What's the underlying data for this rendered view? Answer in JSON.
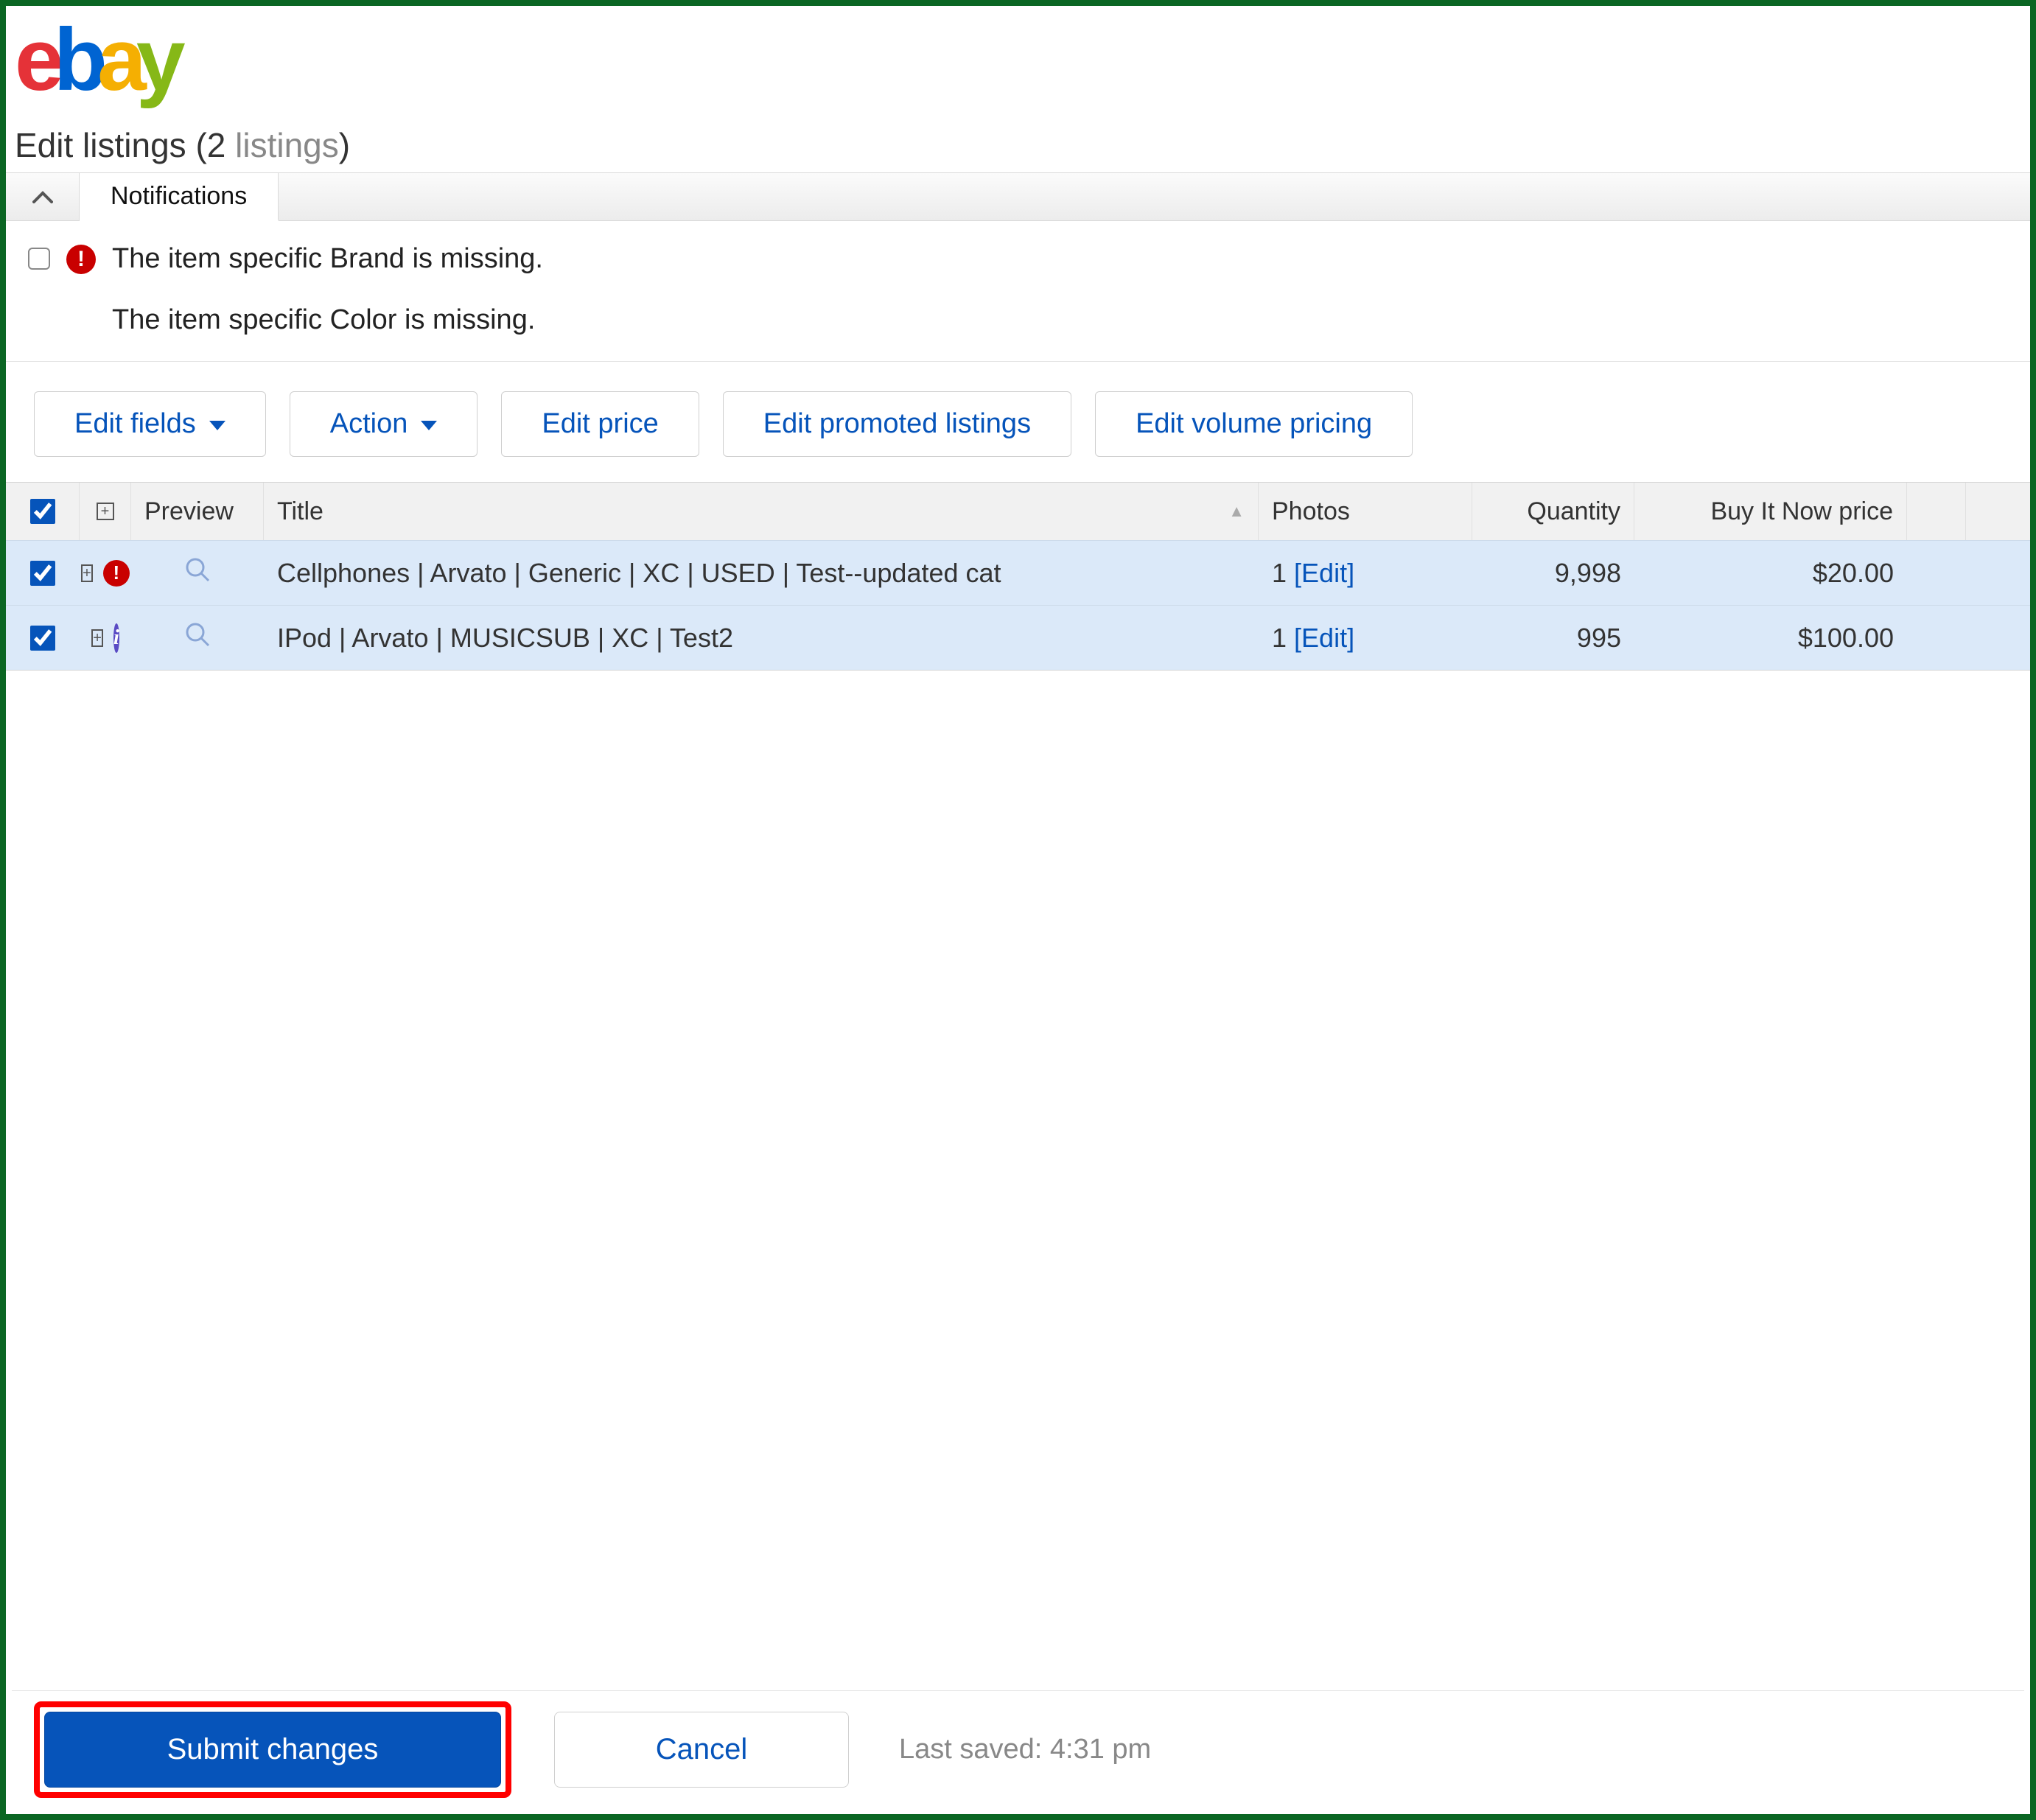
{
  "logo": {
    "letters": [
      "e",
      "b",
      "a",
      "y"
    ],
    "colors": [
      "#e53238",
      "#0064d2",
      "#f5af02",
      "#86b817"
    ]
  },
  "heading": {
    "title": "Edit listings",
    "count": "2",
    "suffix": "listings"
  },
  "notifications": {
    "tab_label": "Notifications",
    "messages": [
      "The item specific Brand is missing.",
      "The item specific Color is missing."
    ]
  },
  "toolbar": {
    "edit_fields": "Edit fields",
    "action": "Action",
    "edit_price": "Edit price",
    "edit_promoted": "Edit promoted listings",
    "edit_volume": "Edit volume pricing"
  },
  "table": {
    "headers": {
      "preview": "Preview",
      "title": "Title",
      "photos": "Photos",
      "quantity": "Quantity",
      "price": "Buy It Now price"
    },
    "edit_label": "Edit",
    "rows": [
      {
        "status": "error",
        "title": "Cellphones | Arvato | Generic | XC | USED | Test--updated cat",
        "photos": "1",
        "quantity": "9,998",
        "price": "$20.00"
      },
      {
        "status": "info",
        "title": "IPod | Arvato | MUSICSUB | XC | Test2",
        "photos": "1",
        "quantity": "995",
        "price": "$100.00"
      }
    ]
  },
  "footer": {
    "submit": "Submit changes",
    "cancel": "Cancel",
    "last_saved_label": "Last saved: ",
    "last_saved_time": "4:31 pm"
  }
}
